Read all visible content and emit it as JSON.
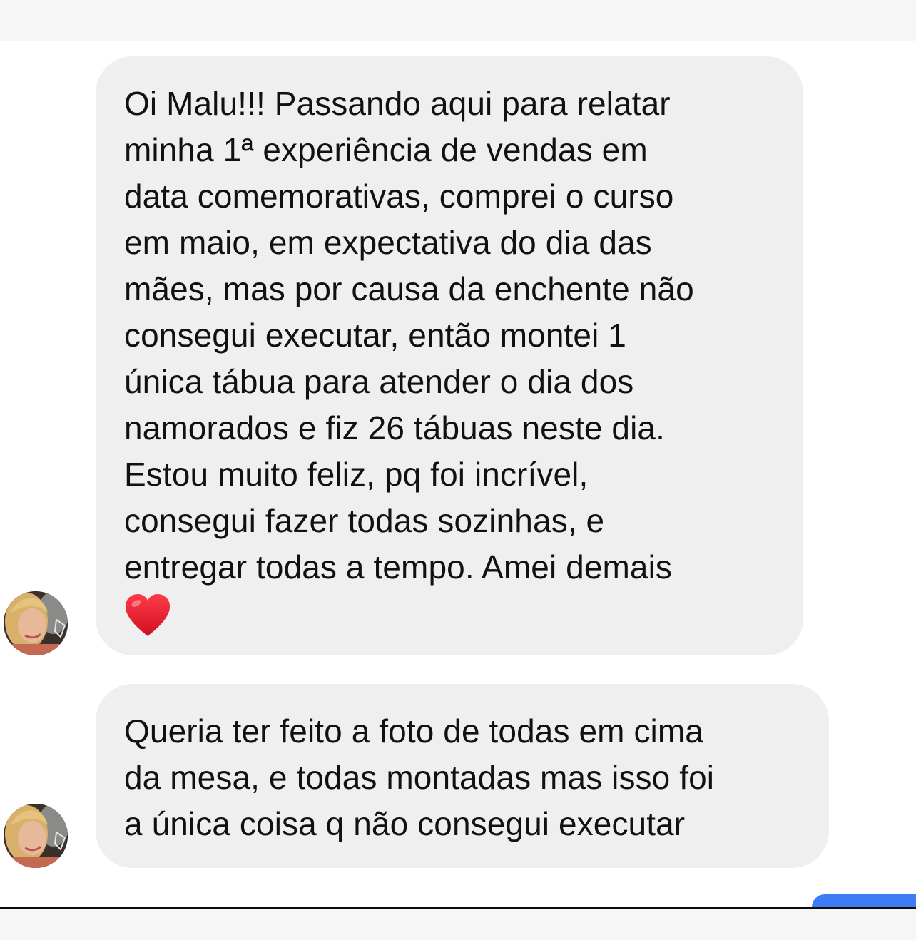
{
  "messages": [
    {
      "lines": [
        "Oi Malu!!! Passando aqui para relatar",
        "minha 1ª experiência de vendas em",
        "data comemorativas, comprei o curso",
        "em maio, em expectativa do dia das",
        "mães, mas por causa da enchente não",
        "consegui executar, então montei 1",
        "única tábua para atender o dia dos",
        "namorados e fiz 26 tábuas neste dia.",
        "Estou muito feliz, pq foi incrível,",
        "consegui fazer todas sozinhas, e",
        "entregar todas a tempo. Amei demais"
      ],
      "emoji": "red-heart"
    },
    {
      "lines": [
        "Queria ter feito a foto de todas em cima",
        "da mesa, e todas montadas mas isso foi",
        "a única coisa q não consegui executar"
      ]
    }
  ],
  "colors": {
    "bubble_background": "#efefef",
    "text": "#111111",
    "heart": "#e8192c",
    "send_accent": "#3d7cf5"
  }
}
